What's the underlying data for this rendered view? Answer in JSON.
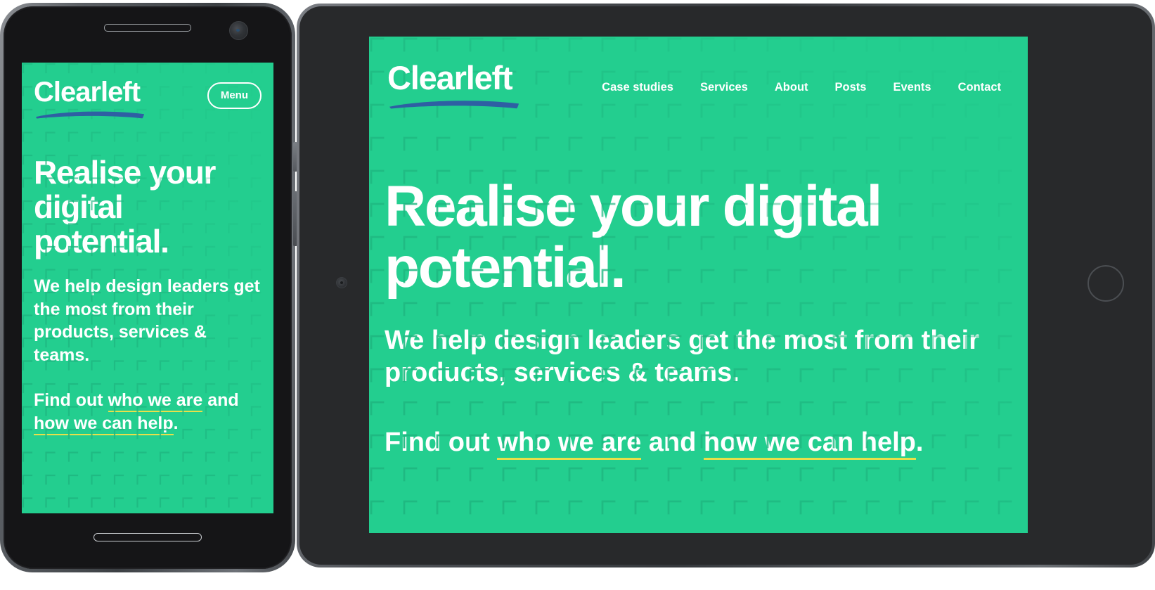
{
  "brand": {
    "name": "Clearleft",
    "green": "#23ce8f",
    "underline_blue": "#2e5fa3",
    "link_underline_yellow": "#e8e04a",
    "text_white": "#ffffff"
  },
  "phone": {
    "menu_button_label": "Menu",
    "heading": "Realise your digital potential.",
    "body": "We help design leaders get the most from their products, services & teams.",
    "link_para": {
      "before": "Find out ",
      "link1": "who we are",
      "middle": " and ",
      "link2": "how we can help",
      "after": "."
    }
  },
  "tablet": {
    "nav": [
      {
        "label": "Case studies"
      },
      {
        "label": "Services"
      },
      {
        "label": "About"
      },
      {
        "label": "Posts"
      },
      {
        "label": "Events"
      },
      {
        "label": "Contact"
      }
    ],
    "heading": "Realise your digital potential.",
    "body": "We help design leaders get the most from their products, services & teams.",
    "link_para": {
      "before": "Find out ",
      "link1": "who we are",
      "middle": " and ",
      "link2": "how we can help",
      "after": "."
    }
  },
  "devices": {
    "phone_name": "smartphone-mockup",
    "tablet_name": "tablet-mockup"
  }
}
